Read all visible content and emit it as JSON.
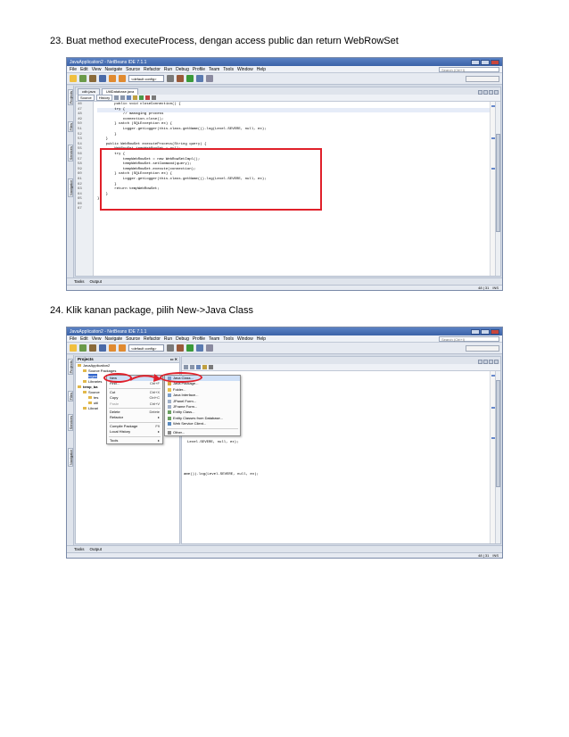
{
  "steps": [
    {
      "number": "23.",
      "text": "Buat method executeProcess, dengan access public dan return WebRowSet"
    },
    {
      "number": "24.",
      "text": "Klik kanan package, pilih New->Java Class"
    }
  ],
  "ide": {
    "window_title": "JavaApplication2 - NetBeans IDE 7.1.1",
    "menu": [
      "File",
      "Edit",
      "View",
      "Navigate",
      "Source",
      "Refactor",
      "Run",
      "Debug",
      "Profile",
      "Team",
      "Tools",
      "Window",
      "Help"
    ],
    "search_placeholder": "Search (Ctrl+I)",
    "config_combo": "<default config>",
    "side_tabs": [
      "Projects",
      "Files",
      "Services",
      "Navigator"
    ],
    "bottom_tabs": [
      "Tasks",
      "Output"
    ],
    "status": {
      "position": "48 | 31",
      "mode": "INS"
    }
  },
  "shot1": {
    "file_tabs": [
      "cdb.java",
      "UtilDatabase.java"
    ],
    "editor_buttons": [
      "Source",
      "History"
    ],
    "line_numbers": [
      "46",
      "47",
      "48",
      "49",
      "50",
      "51",
      "52",
      "53",
      "54",
      "55",
      "56",
      "57",
      "58",
      "59",
      "60",
      "61",
      "62",
      "63",
      "64",
      "65",
      "66",
      "67"
    ],
    "code_lines": [
      "        public void closeConnection() {",
      "        try {",
      "            // managing process",
      "            connection.close();",
      "        } catch (SQLException ex) {",
      "            Logger.getLogger(this.class.getName()).log(Level.SEVERE, null, ex);",
      "        }",
      "    }",
      "",
      "    public WebRowSet executeProcess(String query) {",
      "        WebRowSet tempWebRowSet = null;",
      "        try {",
      "            tempWebRowSet = new WebRowSetImpl();",
      "            tempWebRowSet.setCommand(query);",
      "            tempWebRowSet.execute(connection);",
      "        } catch (SQLException ex) {",
      "            Logger.getLogger(this.class.getName()).log(Level.SEVERE, null, ex);",
      "        }",
      "        return tempWebRowSet;",
      "    }",
      "}",
      ""
    ]
  },
  "shot2": {
    "projects_title": "Projects",
    "tree": [
      "JavaApplication2",
      "Source Packages",
      "tugas",
      "Libraries",
      "temp_ba",
      "Source",
      "tes",
      "util",
      "Librari"
    ],
    "context_menu": [
      {
        "label": "New",
        "shortcut": ""
      },
      {
        "label": "Find...",
        "shortcut": "Ctrl+F"
      },
      {
        "label": "Cut",
        "shortcut": "Ctrl+X"
      },
      {
        "label": "Copy",
        "shortcut": "Ctrl+C"
      },
      {
        "label": "Paste",
        "shortcut": "Ctrl+V"
      },
      {
        "label": "Delete",
        "shortcut": "Delete"
      },
      {
        "label": "Refactor",
        "shortcut": ""
      },
      {
        "label": "Compile Package",
        "shortcut": "F9"
      },
      {
        "label": "Local History",
        "shortcut": ""
      },
      {
        "label": "Tools",
        "shortcut": ""
      }
    ],
    "submenu": [
      "Java Class...",
      "Java Package...",
      "Folder...",
      "Java Interface...",
      "JPanel Form...",
      "JFrame Form...",
      "Entity Class...",
      "Entity Classes from Database...",
      "Web Service Client...",
      "Other..."
    ],
    "code_fragments": [
      "Level.SEVERE, null, ex);",
      "Level.SEVERE, null, ex);",
      "ame()).log(Level.SEVERE, null, ex);"
    ]
  }
}
